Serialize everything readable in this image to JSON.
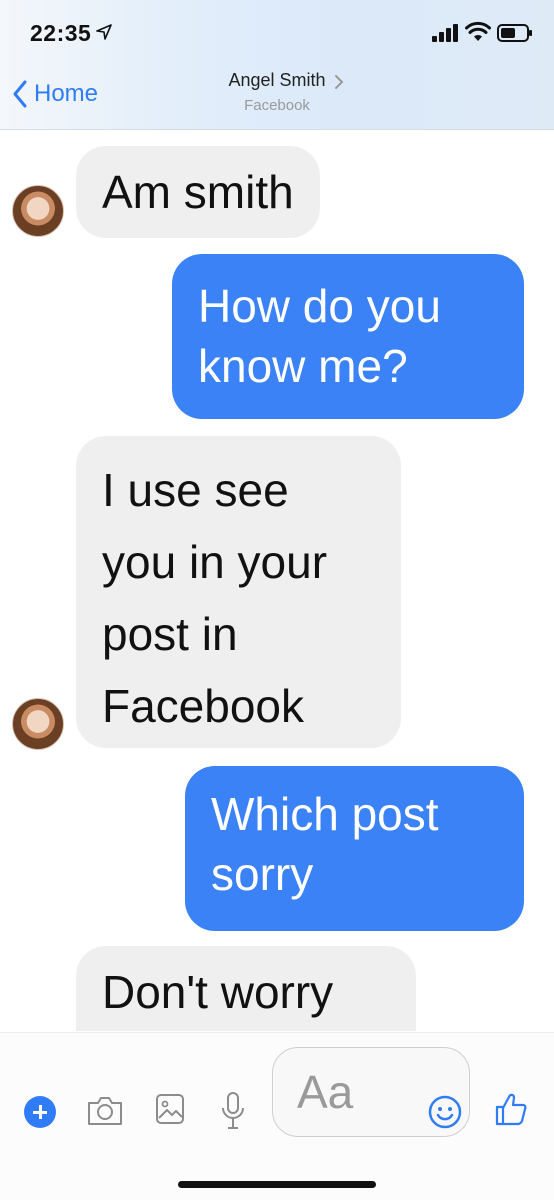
{
  "status_bar": {
    "time": "22:35"
  },
  "nav": {
    "back_label": "Home",
    "contact_name": "Angel Smith",
    "contact_subtitle": "Facebook"
  },
  "messages": [
    {
      "direction": "incoming",
      "text": "Am smith"
    },
    {
      "direction": "outgoing",
      "text": "How do you\nknow me?"
    },
    {
      "direction": "incoming",
      "text": "I use see\nyou in your\npost in\nFacebook"
    },
    {
      "direction": "outgoing",
      "text": "Which post\nsorry"
    },
    {
      "direction": "incoming",
      "text": "Don't worry"
    }
  ],
  "composer": {
    "placeholder": "Aa"
  },
  "colors": {
    "accent": "#2f7cf6",
    "outgoing_bubble": "#3b82f6",
    "incoming_bubble": "#efefef"
  },
  "icons": [
    "location-arrow-icon",
    "signal-icon",
    "wifi-icon",
    "battery-icon",
    "back-chevron-icon",
    "plus-icon",
    "camera-icon",
    "gallery-icon",
    "microphone-icon",
    "emoji-icon",
    "like-icon"
  ]
}
